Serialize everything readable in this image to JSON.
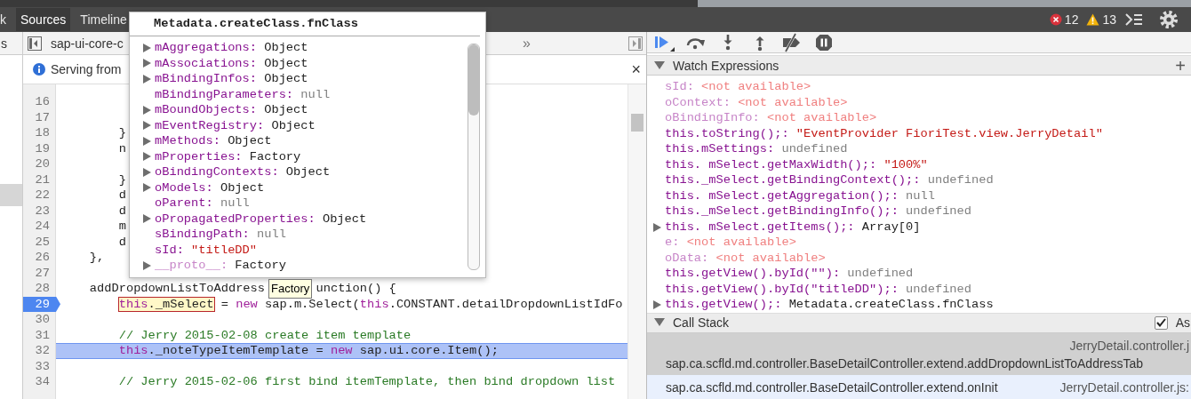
{
  "top_tabs": [
    {
      "label": "k",
      "selected": false
    },
    {
      "label": "Sources",
      "selected": true
    },
    {
      "label": "Timeline",
      "selected": false
    }
  ],
  "error_count": "12",
  "warning_count": "13",
  "navigator": {
    "tab": "s"
  },
  "editor": {
    "file_tab": "sap-ui-core-c",
    "overflow": "»",
    "info": "Serving from",
    "close": "×",
    "lines": [
      {
        "number": "16",
        "breakpoint": false,
        "current": false
      },
      {
        "number": "17",
        "breakpoint": false,
        "current": false
      },
      {
        "number": "18",
        "text": "        }",
        "breakpoint": false,
        "current": false
      },
      {
        "number": "19",
        "text": "        n",
        "breakpoint": false,
        "current": false
      },
      {
        "number": "20",
        "breakpoint": false,
        "current": false
      },
      {
        "number": "21",
        "text": "        }",
        "breakpoint": false,
        "current": false
      },
      {
        "number": "22",
        "text": "        d",
        "breakpoint": false,
        "current": false
      },
      {
        "number": "23",
        "text": "        d",
        "breakpoint": false,
        "current": false
      },
      {
        "number": "24",
        "text": "        m",
        "breakpoint": false,
        "current": false
      },
      {
        "number": "25",
        "text": "        d",
        "breakpoint": false,
        "current": false
      },
      {
        "number": "26",
        "text": "    },",
        "breakpoint": false,
        "current": false
      },
      {
        "number": "27",
        "breakpoint": false,
        "current": false
      },
      {
        "number": "28",
        "segments": [
          "    addDropdownListToAddress",
          "unction() {"
        ],
        "breakpoint": false,
        "current": false
      },
      {
        "number": "29",
        "parts": [
          {
            "text": "        this._mSelect",
            "marked": true
          },
          {
            "text": " = new sap.m.Select(this.CONSTANT.detailDropdownListIdFo",
            "marked": false
          }
        ],
        "breakpoint": true,
        "current": false
      },
      {
        "number": "30",
        "breakpoint": false,
        "current": false
      },
      {
        "number": "31",
        "text": "        // Jerry 2015-02-08 create item template",
        "breakpoint": false,
        "current": false
      },
      {
        "number": "32",
        "text": "        this._noteTypeItemTemplate = new sap.ui.core.Item();",
        "breakpoint": false,
        "current": true
      },
      {
        "number": "33",
        "breakpoint": false,
        "current": false
      },
      {
        "number": "34",
        "text": "        // Jerry 2015-02-06 first bind itemTemplate, then bind dropdown list",
        "breakpoint": false,
        "current": false
      }
    ]
  },
  "popup": {
    "title": "Metadata.createClass.fnClass",
    "tooltip": "Factory",
    "properties": [
      {
        "key": "mAggregations:",
        "value": "Object",
        "kind": "object",
        "expandable": true,
        "enumerable": true
      },
      {
        "key": "mAssociations:",
        "value": "Object",
        "kind": "object",
        "expandable": true,
        "enumerable": true
      },
      {
        "key": "mBindingInfos:",
        "value": "Object",
        "kind": "object",
        "expandable": true,
        "enumerable": true
      },
      {
        "key": "mBindingParameters:",
        "value": "null",
        "kind": "empty",
        "expandable": false,
        "enumerable": true
      },
      {
        "key": "mBoundObjects:",
        "value": "Object",
        "kind": "object",
        "expandable": true,
        "enumerable": true
      },
      {
        "key": "mEventRegistry:",
        "value": "Object",
        "kind": "object",
        "expandable": true,
        "enumerable": true
      },
      {
        "key": "mMethods:",
        "value": "Object",
        "kind": "object",
        "expandable": true,
        "enumerable": true
      },
      {
        "key": "mProperties:",
        "value": "Factory",
        "kind": "object",
        "expandable": true,
        "enumerable": true
      },
      {
        "key": "oBindingContexts:",
        "value": "Object",
        "kind": "object",
        "expandable": true,
        "enumerable": true
      },
      {
        "key": "oModels:",
        "value": "Object",
        "kind": "object",
        "expandable": true,
        "enumerable": true
      },
      {
        "key": "oParent:",
        "value": "null",
        "kind": "empty",
        "expandable": false,
        "enumerable": true
      },
      {
        "key": "oPropagatedProperties:",
        "value": "Object",
        "kind": "object",
        "expandable": true,
        "enumerable": true
      },
      {
        "key": "sBindingPath:",
        "value": "null",
        "kind": "empty",
        "expandable": false,
        "enumerable": true
      },
      {
        "key": "sId:",
        "value": "\"titleDD\"",
        "kind": "string",
        "expandable": false,
        "enumerable": true
      },
      {
        "key": "__proto__:",
        "value": "Factory",
        "kind": "object",
        "expandable": true,
        "enumerable": false
      }
    ]
  },
  "watch": {
    "title": "Watch Expressions",
    "add": "+",
    "expressions": [
      {
        "name": "sId:",
        "value": "<not available>",
        "kind": "unavailable",
        "expandable": false
      },
      {
        "name": "oContext:",
        "value": "<not available>",
        "kind": "unavailable",
        "expandable": false
      },
      {
        "name": "oBindingInfo:",
        "value": "<not available>",
        "kind": "unavailable",
        "expandable": false
      },
      {
        "name": "this.toString();:",
        "value": "\"EventProvider FioriTest.view.JerryDetail\"",
        "kind": "string",
        "expandable": false
      },
      {
        "name": "this.mSettings:",
        "value": "undefined",
        "kind": "empty",
        "expandable": false
      },
      {
        "name": "this. mSelect.getMaxWidth();:",
        "value": "\"100%\"",
        "kind": "string",
        "expandable": false
      },
      {
        "name": "this._mSelect.getBindingContext();:",
        "value": "undefined",
        "kind": "empty",
        "expandable": false
      },
      {
        "name": "this. mSelect.getAggregation();:",
        "value": "null",
        "kind": "empty",
        "expandable": false
      },
      {
        "name": "this._mSelect.getBindingInfo();:",
        "value": "undefined",
        "kind": "empty",
        "expandable": false
      },
      {
        "name": "this. mSelect.getItems();:",
        "value": "Array[0]",
        "kind": "object",
        "expandable": true
      },
      {
        "name": "e:",
        "value": "<not available>",
        "kind": "unavailable",
        "expandable": false
      },
      {
        "name": "oData:",
        "value": "<not available>",
        "kind": "unavailable",
        "expandable": false
      },
      {
        "name": "this.getView().byId(\"\"):",
        "value": "undefined",
        "kind": "empty",
        "expandable": false
      },
      {
        "name": "this.getView().byId(\"titleDD\");:",
        "value": "undefined",
        "kind": "empty",
        "expandable": false
      },
      {
        "name": "this.getView();:",
        "value": "Metadata.createClass.fnClass",
        "kind": "object",
        "expandable": true
      }
    ]
  },
  "call_stack": {
    "title": "Call Stack",
    "async": {
      "label": "As",
      "checked": true
    },
    "frames": [
      {
        "function": "sap.ca.scfld.md.controller.BaseDetailController.extend.addDropdownListToAddressTab",
        "file": "JerryDetail.controller.j",
        "selected": true,
        "hovered": false
      },
      {
        "function": "sap.ca.scfld.md.controller.BaseDetailController.extend.onInit",
        "file": "JerryDetail.controller.js:",
        "selected": false,
        "hovered": true
      }
    ]
  }
}
